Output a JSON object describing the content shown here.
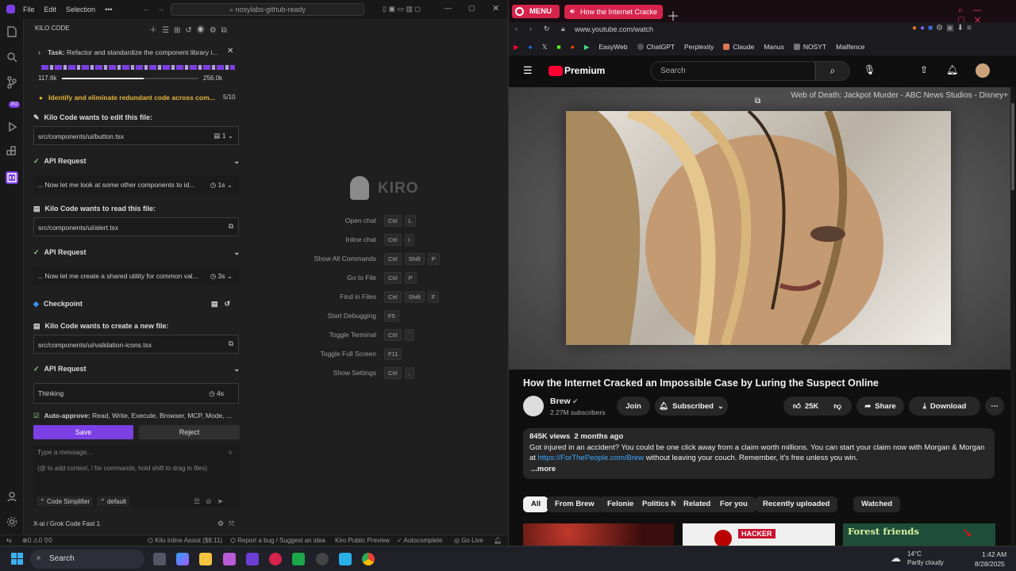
{
  "ide": {
    "menu": [
      "File",
      "Edit",
      "Selection"
    ],
    "command_center": "nosylabs-github-ready",
    "panel_title": "KILO CODE",
    "activity_badge": "352",
    "task": {
      "label": "Task:",
      "text": "Refactor and standardize the component library i...",
      "tokens_in": "117.6k",
      "tokens_max": "256.0k",
      "progress": 0.6
    },
    "todo": {
      "text": "Identify and eliminate redundant code across com...",
      "count": "5/10"
    },
    "items": [
      {
        "title": "Kilo Code wants to edit this file:",
        "field": "src/components/ui/button.tsx",
        "badge": "1"
      },
      {
        "title": "API Request",
        "field": "... Now let me look at some other components to id...",
        "time": "1s"
      },
      {
        "title": "Kilo Code wants to read this file:",
        "field": "src/components/ui/alert.tsx"
      },
      {
        "title": "API Request",
        "field": "... Now let me create a shared utility for common val...",
        "time": "3s"
      },
      {
        "title": "Checkpoint"
      },
      {
        "title": "Kilo Code wants to create a new file:",
        "field": "src/components/ui/validation-icons.tsx"
      },
      {
        "title": "API Request",
        "field": "Thinking",
        "time": "4s"
      }
    ],
    "auto_approve": {
      "label": "Auto-approve:",
      "text": "Read, Write, Execute, Browser, MCP, Mode, ..."
    },
    "save_label": "Save",
    "reject_label": "Reject",
    "message_placeholder": "Type a message...",
    "message_hint": "(@ to add context, / for commands, hold shift to drag in files)",
    "mode": "Code Simplifier",
    "profile": "default",
    "model": "X-ai / Grok Code Fast 1",
    "welcome_logo": "KIRO",
    "shortcuts": [
      {
        "label": "Open chat",
        "keys": [
          "Ctrl",
          "L"
        ]
      },
      {
        "label": "Inline chat",
        "keys": [
          "Ctrl",
          "I"
        ]
      },
      {
        "label": "Show All Commands",
        "keys": [
          "Ctrl",
          "Shift",
          "P"
        ]
      },
      {
        "label": "Go to File",
        "keys": [
          "Ctrl",
          "P"
        ]
      },
      {
        "label": "Find in Files",
        "keys": [
          "Ctrl",
          "Shift",
          "F"
        ]
      },
      {
        "label": "Start Debugging",
        "keys": [
          "F5"
        ]
      },
      {
        "label": "Toggle Terminal",
        "keys": [
          "Ctrl",
          "`"
        ]
      },
      {
        "label": "Toggle Full Screen",
        "keys": [
          "F11"
        ]
      },
      {
        "label": "Show Settings",
        "keys": [
          "Ctrl",
          ","
        ]
      }
    ],
    "status": {
      "errors": "0",
      "warnings": "0",
      "ports": "0",
      "inline_assist": "Kilo Inline Assist ($8.11)",
      "report": "Report a bug / Suggest an idea",
      "preview": "Kiro Public Preview",
      "autocomplete": "Autocomplete",
      "golive": "Go Live"
    }
  },
  "browser": {
    "menu": "MENU",
    "tab_title": "How the Internet Cracke",
    "url": "www.youtube.com/watch",
    "bookmarks": [
      "EasyWeb",
      "ChatGPT",
      "Perplexity",
      "Claude",
      "Manus",
      "NOSYT",
      "Mailfence"
    ],
    "yt_logo": "Premium",
    "search_placeholder": "Search",
    "overlay_title": "Web of Death: Jackpot Murder - ABC News Studios - Disney+",
    "video_title": "How the Internet Cracked an Impossible Case by Luring the Suspect Online",
    "channel": "Brew",
    "subscribers": "2.27M subscribers",
    "join": "Join",
    "subscribed": "Subscribed",
    "likes": "25K",
    "share": "Share",
    "download": "Download",
    "views": "845K views",
    "age": "2 months ago",
    "desc_text": "Got injured in an accident? You could be one click away from a claim worth millions. You can start your claim now with Morgan & Morgan at",
    "desc_link": "https://ForThePeople.com/Brew",
    "desc_tail": "without leaving your couch. Remember, it's free unless you win.",
    "more": "...more",
    "chips": [
      "All",
      "From Brew",
      "Felonies",
      "Politics News",
      "Related",
      "For you",
      "Recently uploaded",
      "Watched"
    ],
    "thumb_labels": [
      "HACKER",
      "Forest friends"
    ]
  },
  "taskbar": {
    "search": "Search",
    "temp": "14°C",
    "weather": "Partly cloudy",
    "time": "1:42 AM",
    "date": "8/28/2025"
  },
  "colors": {
    "accent": "#7b3fe4",
    "yt_red": "#ff0033",
    "link": "#3ea6ff"
  }
}
